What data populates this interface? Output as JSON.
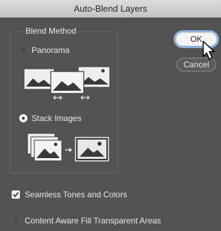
{
  "dialog": {
    "title": "Auto-Blend Layers"
  },
  "blend_method": {
    "legend": "Blend Method",
    "options": [
      {
        "label": "Panorama",
        "selected": false
      },
      {
        "label": "Stack Images",
        "selected": true
      }
    ]
  },
  "buttons": {
    "ok_label": "OK",
    "cancel_label": "Cancel"
  },
  "options": {
    "seamless": {
      "label": "Seamless Tones and Colors",
      "checked": true
    },
    "content_aware": {
      "label": "Content Aware Fill Transparent Areas",
      "checked": false
    }
  },
  "colors": {
    "dialog_bg": "#535353",
    "accent_focus": "#8fb0d6"
  }
}
